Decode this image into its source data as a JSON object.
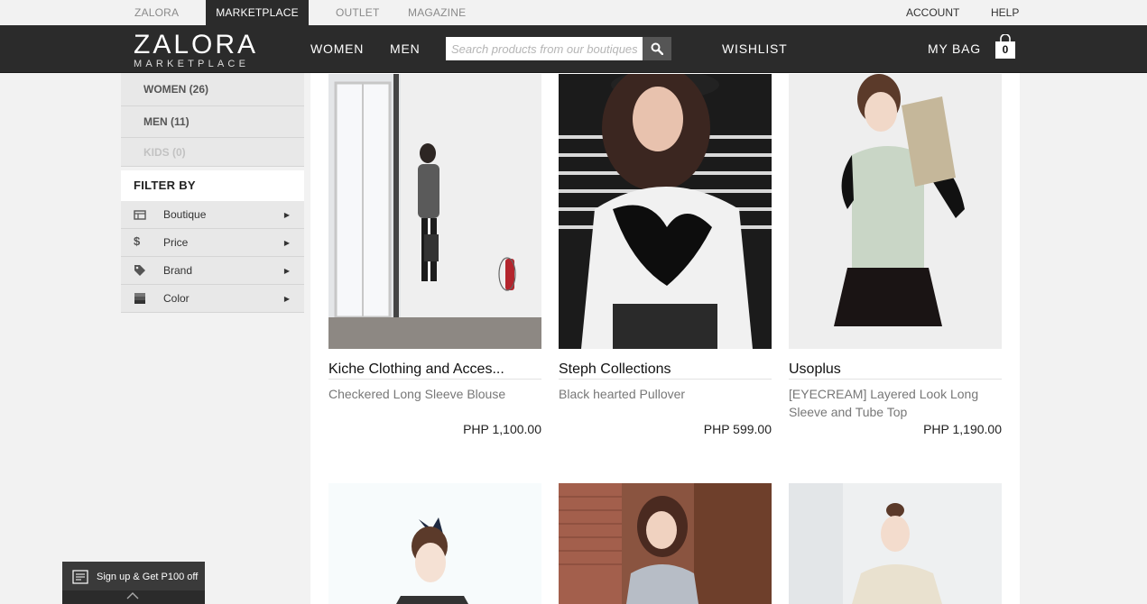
{
  "topbar": {
    "tabs": [
      {
        "label": "ZALORA",
        "active": false
      },
      {
        "label": "MARKETPLACE",
        "active": true
      },
      {
        "label": "OUTLET",
        "active": false
      },
      {
        "label": "MAGAZINE",
        "active": false
      }
    ],
    "account_label": "ACCOUNT",
    "help_label": "HELP"
  },
  "header": {
    "logo_line1": "ZALORA",
    "logo_line2": "MARKETPLACE",
    "nav": {
      "women": "WOMEN",
      "men": "MEN",
      "wishlist": "WISHLIST",
      "my_bag": "MY BAG"
    },
    "search_placeholder": "Search products from our boutiques",
    "bag_count": "0"
  },
  "sidebar": {
    "categories": [
      {
        "label": "WOMEN (26)",
        "enabled": true
      },
      {
        "label": "MEN (11)",
        "enabled": true
      },
      {
        "label": "KIDS (0)",
        "enabled": false
      }
    ],
    "filter_title": "FILTER BY",
    "filters": [
      {
        "label": "Boutique",
        "icon": "boutique-icon"
      },
      {
        "label": "Price",
        "icon": "dollar-icon"
      },
      {
        "label": "Brand",
        "icon": "tag-icon"
      },
      {
        "label": "Color",
        "icon": "color-swatch-icon"
      }
    ]
  },
  "products": [
    {
      "brand": "Kiche Clothing and Acces...",
      "name": "Checkered Long Sleeve Blouse",
      "price": "PHP 1,100.00"
    },
    {
      "brand": "Steph Collections",
      "name": "Black hearted Pullover",
      "price": "PHP 599.00"
    },
    {
      "brand": "Usoplus",
      "name": "[EYECREAM] Layered Look Long Sleeve and Tube Top",
      "price": "PHP 1,190.00"
    }
  ],
  "signup": {
    "label": "Sign up & Get P100 off"
  },
  "colors": {
    "header_bg": "#2b2b2b",
    "page_bg": "#f2f2f2",
    "sidebar_bg": "#e8e8e8"
  }
}
